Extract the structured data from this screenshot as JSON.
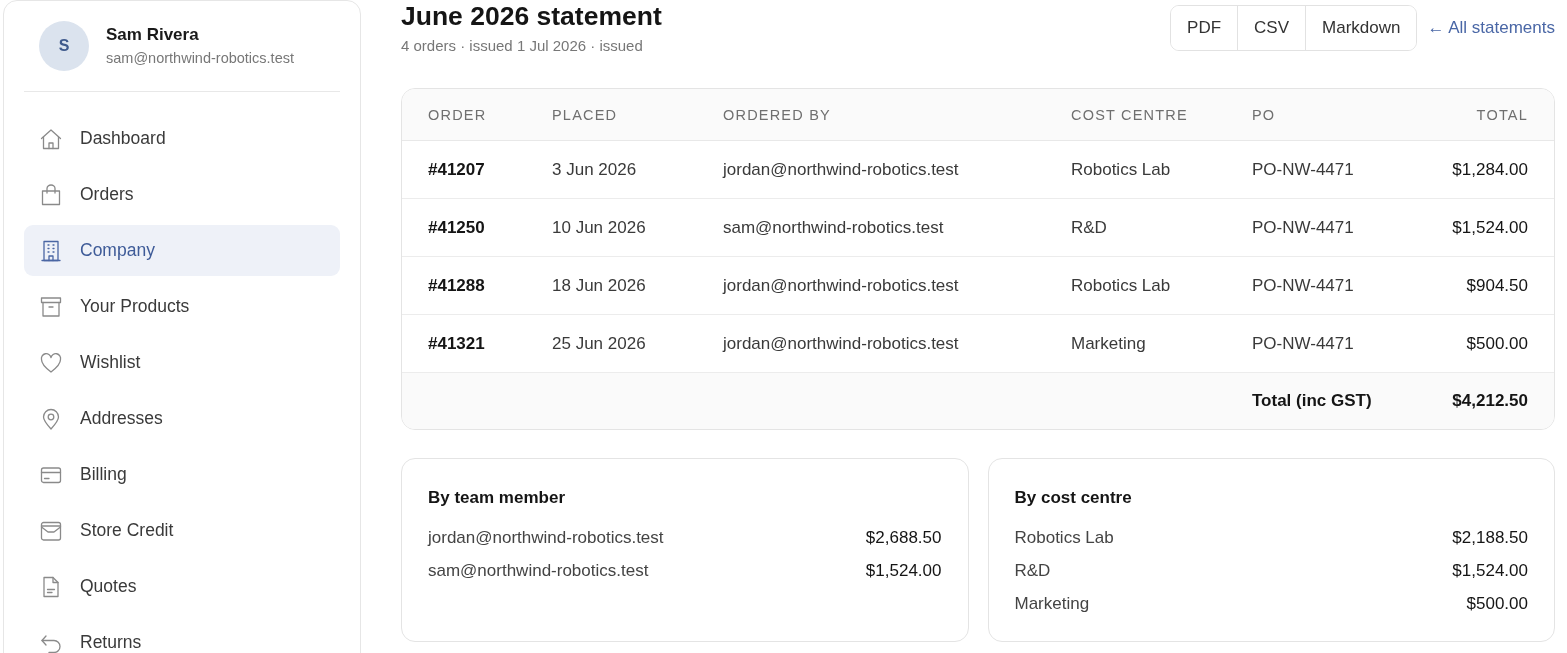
{
  "sidebar": {
    "user": {
      "initial": "S",
      "name": "Sam Rivera",
      "email": "sam@northwind-robotics.test"
    },
    "items": [
      {
        "label": "Dashboard",
        "selected": false
      },
      {
        "label": "Orders",
        "selected": false
      },
      {
        "label": "Company",
        "selected": true
      },
      {
        "label": "Your Products",
        "selected": false
      },
      {
        "label": "Wishlist",
        "selected": false
      },
      {
        "label": "Addresses",
        "selected": false
      },
      {
        "label": "Billing",
        "selected": false
      },
      {
        "label": "Store Credit",
        "selected": false
      },
      {
        "label": "Quotes",
        "selected": false
      },
      {
        "label": "Returns",
        "selected": false
      }
    ]
  },
  "header": {
    "title": "June 2026 statement",
    "subtitle": "4 orders · issued 1 Jul 2026 · issued",
    "export_buttons": [
      "PDF",
      "CSV",
      "Markdown"
    ],
    "back_link": "← All statements"
  },
  "table": {
    "columns": [
      "ORDER",
      "PLACED",
      "ORDERED BY",
      "COST CENTRE",
      "PO",
      "TOTAL"
    ],
    "rows": [
      {
        "cells": [
          "#41207",
          "3 Jun 2026",
          "jordan@northwind-robotics.test",
          "Robotics Lab",
          "PO-NW-4471",
          "$1,284.00"
        ]
      },
      {
        "cells": [
          "#41250",
          "10 Jun 2026",
          "sam@northwind-robotics.test",
          "R&D",
          "PO-NW-4471",
          "$1,524.00"
        ]
      },
      {
        "cells": [
          "#41288",
          "18 Jun 2026",
          "jordan@northwind-robotics.test",
          "Robotics Lab",
          "PO-NW-4471",
          "$904.50"
        ]
      },
      {
        "cells": [
          "#41321",
          "25 Jun 2026",
          "jordan@northwind-robotics.test",
          "Marketing",
          "PO-NW-4471",
          "$500.00"
        ]
      }
    ],
    "footer": {
      "label": "Total (inc GST)",
      "value": "$4,212.50"
    }
  },
  "summaries": [
    {
      "title": "By team member",
      "rows": [
        {
          "label": "jordan@northwind-robotics.test",
          "amount": "$2,688.50"
        },
        {
          "label": "sam@northwind-robotics.test",
          "amount": "$1,524.00"
        }
      ]
    },
    {
      "title": "By cost centre",
      "rows": [
        {
          "label": "Robotics Lab",
          "amount": "$2,188.50"
        },
        {
          "label": "R&D",
          "amount": "$1,524.00"
        },
        {
          "label": "Marketing",
          "amount": "$500.00"
        }
      ]
    }
  ]
}
